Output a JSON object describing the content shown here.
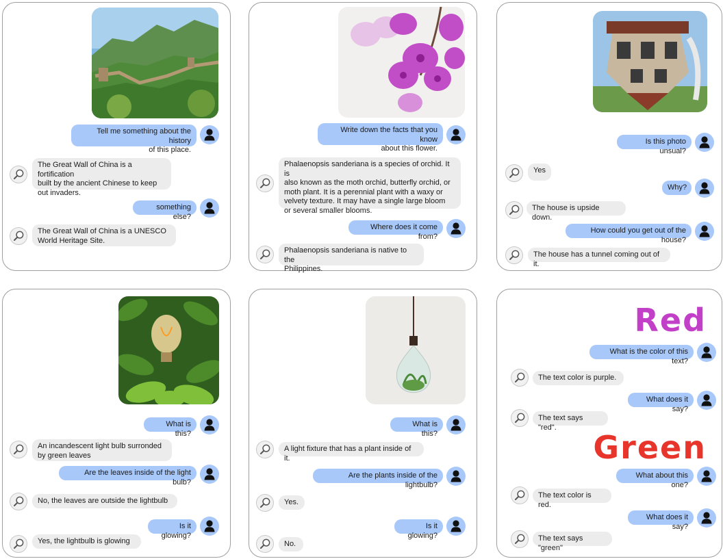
{
  "colors": {
    "user_bubble": "#a8c8fa",
    "bot_bubble": "#ececec",
    "panel_border": "#9e9e9e"
  },
  "icons": {
    "user": "person-icon",
    "bot": "magnifier-icon"
  },
  "panels": [
    {
      "image": "great-wall-photo",
      "messages": [
        {
          "role": "user",
          "text": "Tell me something about the history\nof this place."
        },
        {
          "role": "bot",
          "text": "The Great Wall of China is a fortification\nbuilt by the ancient Chinese to keep\nout invaders."
        },
        {
          "role": "user",
          "text": "something else?"
        },
        {
          "role": "bot",
          "text": "The Great Wall of China is a UNESCO\nWorld Heritage Site."
        }
      ]
    },
    {
      "image": "orchid-photo",
      "messages": [
        {
          "role": "user",
          "text": "Write down the facts that you know\nabout this flower."
        },
        {
          "role": "bot",
          "text": "Phalaenopsis sanderiana is a species of orchid. It is\nalso known as the moth orchid, butterfly orchid, or\nmoth plant. It is a perennial plant with a waxy or\nvelvety texture. It may have a single large bloom\nor several smaller blooms."
        },
        {
          "role": "user",
          "text": "Where does it come from?"
        },
        {
          "role": "bot",
          "text": "Phalaenopsis sanderiana is native to the\nPhilippines."
        }
      ]
    },
    {
      "image": "upside-down-house-photo",
      "messages": [
        {
          "role": "user",
          "text": "Is this photo unsual?"
        },
        {
          "role": "bot",
          "text": "Yes"
        },
        {
          "role": "user",
          "text": "Why?"
        },
        {
          "role": "bot",
          "text": "The house is upside down."
        },
        {
          "role": "user",
          "text": "How could you get out of the house?"
        },
        {
          "role": "bot",
          "text": "The house has a tunnel coming out of it."
        }
      ]
    },
    {
      "image": "lightbulb-leaves-photo",
      "messages": [
        {
          "role": "user",
          "text": "What is this?"
        },
        {
          "role": "bot",
          "text": "An incandescent light bulb surronded\nby green leaves"
        },
        {
          "role": "user",
          "text": "Are the leaves inside of the light bulb?"
        },
        {
          "role": "bot",
          "text": "No, the leaves are outside the lightbulb"
        },
        {
          "role": "user",
          "text": "Is it glowing?"
        },
        {
          "role": "bot",
          "text": "Yes, the lightbulb is glowing"
        }
      ]
    },
    {
      "image": "plant-lightbulb-photo",
      "messages": [
        {
          "role": "user",
          "text": "What is this?"
        },
        {
          "role": "bot",
          "text": "A light fixture that has a plant inside of it."
        },
        {
          "role": "user",
          "text": "Are the plants inside of the lightbulb?"
        },
        {
          "role": "bot",
          "text": "Yes."
        },
        {
          "role": "user",
          "text": "Is it glowing?"
        },
        {
          "role": "bot",
          "text": "No."
        }
      ]
    },
    {
      "image": "color-text-images",
      "big_texts": [
        {
          "text": "Red",
          "color": "#c23fc8"
        },
        {
          "text": "Green",
          "color": "#e8352b"
        }
      ],
      "messages": [
        {
          "role": "user",
          "text": "What is the color of this text?"
        },
        {
          "role": "bot",
          "text": "The text color is purple."
        },
        {
          "role": "user",
          "text": "What does it say?"
        },
        {
          "role": "bot",
          "text": "The text says \"red\"."
        },
        {
          "role": "user",
          "text": "What about this one?"
        },
        {
          "role": "bot",
          "text": "The text color is red."
        },
        {
          "role": "user",
          "text": "What does it say?"
        },
        {
          "role": "bot",
          "text": "The text says \"green\""
        }
      ]
    }
  ]
}
